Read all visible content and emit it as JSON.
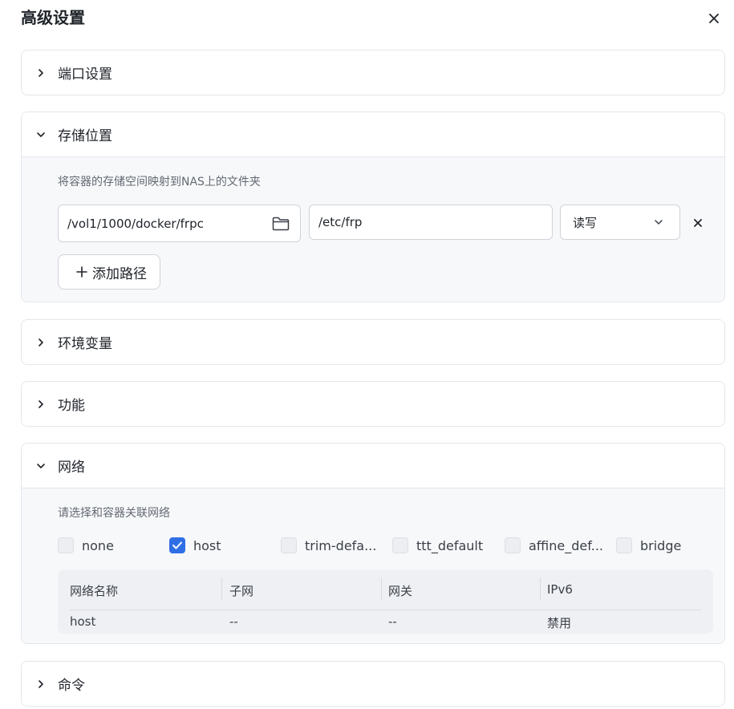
{
  "dialog": {
    "title": "高级设置"
  },
  "sections": {
    "ports": {
      "title": "端口设置"
    },
    "storage": {
      "title": "存储位置",
      "hint": "将容器的存储空间映射到NAS上的文件夹",
      "host_path": "/vol1/1000/docker/frpc",
      "container_path": "/etc/frp",
      "permission": "读写",
      "add_label": "添加路径"
    },
    "env": {
      "title": "环境变量"
    },
    "features": {
      "title": "功能"
    },
    "network": {
      "title": "网络",
      "hint": "请选择和容器关联网络",
      "options": [
        {
          "label": "none",
          "checked": false
        },
        {
          "label": "host",
          "checked": true
        },
        {
          "label": "trim-defa...",
          "checked": false
        },
        {
          "label": "ttt_default",
          "checked": false
        },
        {
          "label": "affine_def...",
          "checked": false
        },
        {
          "label": "bridge",
          "checked": false
        }
      ],
      "table": {
        "headers": [
          "网络名称",
          "子网",
          "网关",
          "IPv6"
        ],
        "rows": [
          [
            "host",
            "--",
            "--",
            "禁用"
          ]
        ]
      }
    },
    "command": {
      "title": "命令"
    }
  },
  "colors": {
    "accent": "#2f6fe6",
    "border": "#e3e6eb",
    "panel_bg": "#f7f8fa"
  },
  "icons": [
    "close-icon",
    "chevron-right-icon",
    "chevron-down-icon",
    "folder-icon",
    "plus-icon",
    "check-icon"
  ]
}
